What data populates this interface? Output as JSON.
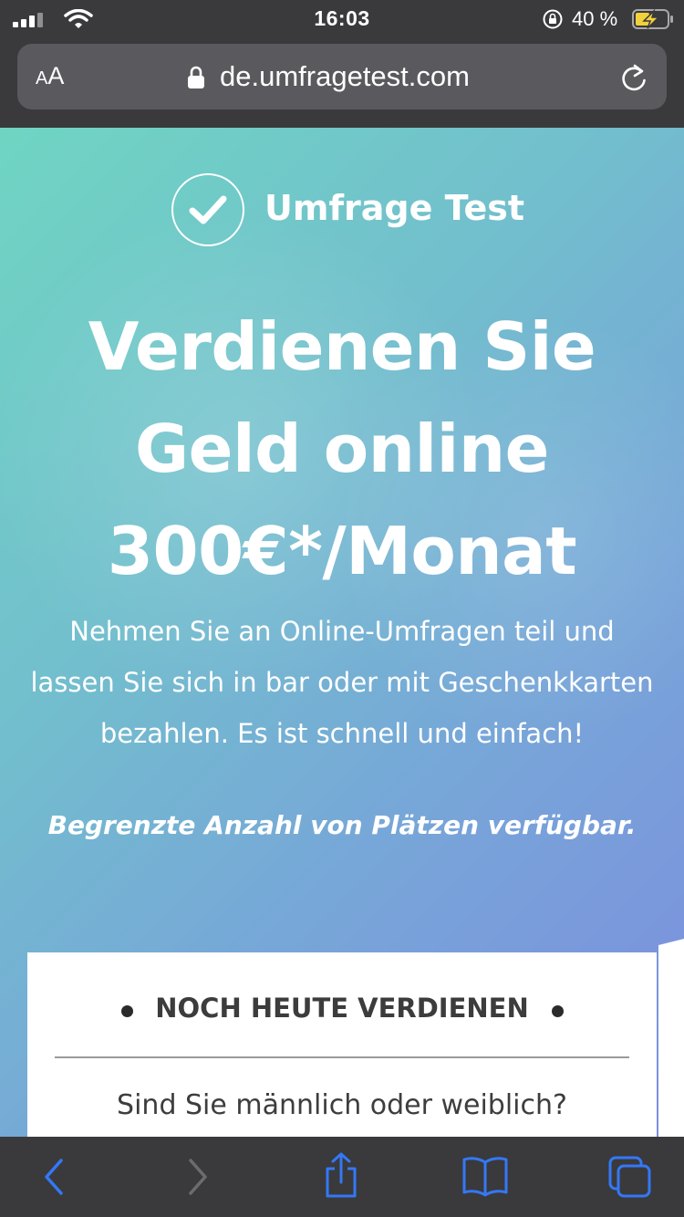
{
  "status_bar": {
    "time": "16:03",
    "battery_percent": "40 %",
    "signal_bars": 3,
    "charging": true
  },
  "address_bar": {
    "text_size_small": "A",
    "text_size_large": "A",
    "url": "de.umfragetest.com",
    "icons": [
      "lock-icon",
      "reload-icon"
    ]
  },
  "hero": {
    "logo_text": "Umfrage Test",
    "headline": [
      "Verdienen Sie",
      "Geld online",
      "300€*/Monat"
    ],
    "description": "Nehmen Sie an Online-Umfragen teil und lassen Sie sich in bar oder mit Geschenkkarten bezahlen. Es ist schnell und einfach!",
    "limited": "Begrenzte Anzahl von Plätzen verfügbar.",
    "gradient": [
      "#6fd5c2",
      "#77a6d8",
      "#7d8ddf"
    ]
  },
  "form_card": {
    "title": "NOCH HEUTE VERDIENEN",
    "question": "Sind Sie männlich oder weiblich?"
  },
  "toolbar": {
    "icons": [
      "back-icon",
      "forward-icon",
      "share-icon",
      "bookmarks-icon",
      "tabs-icon"
    ],
    "accent_color": "#3478f6"
  }
}
